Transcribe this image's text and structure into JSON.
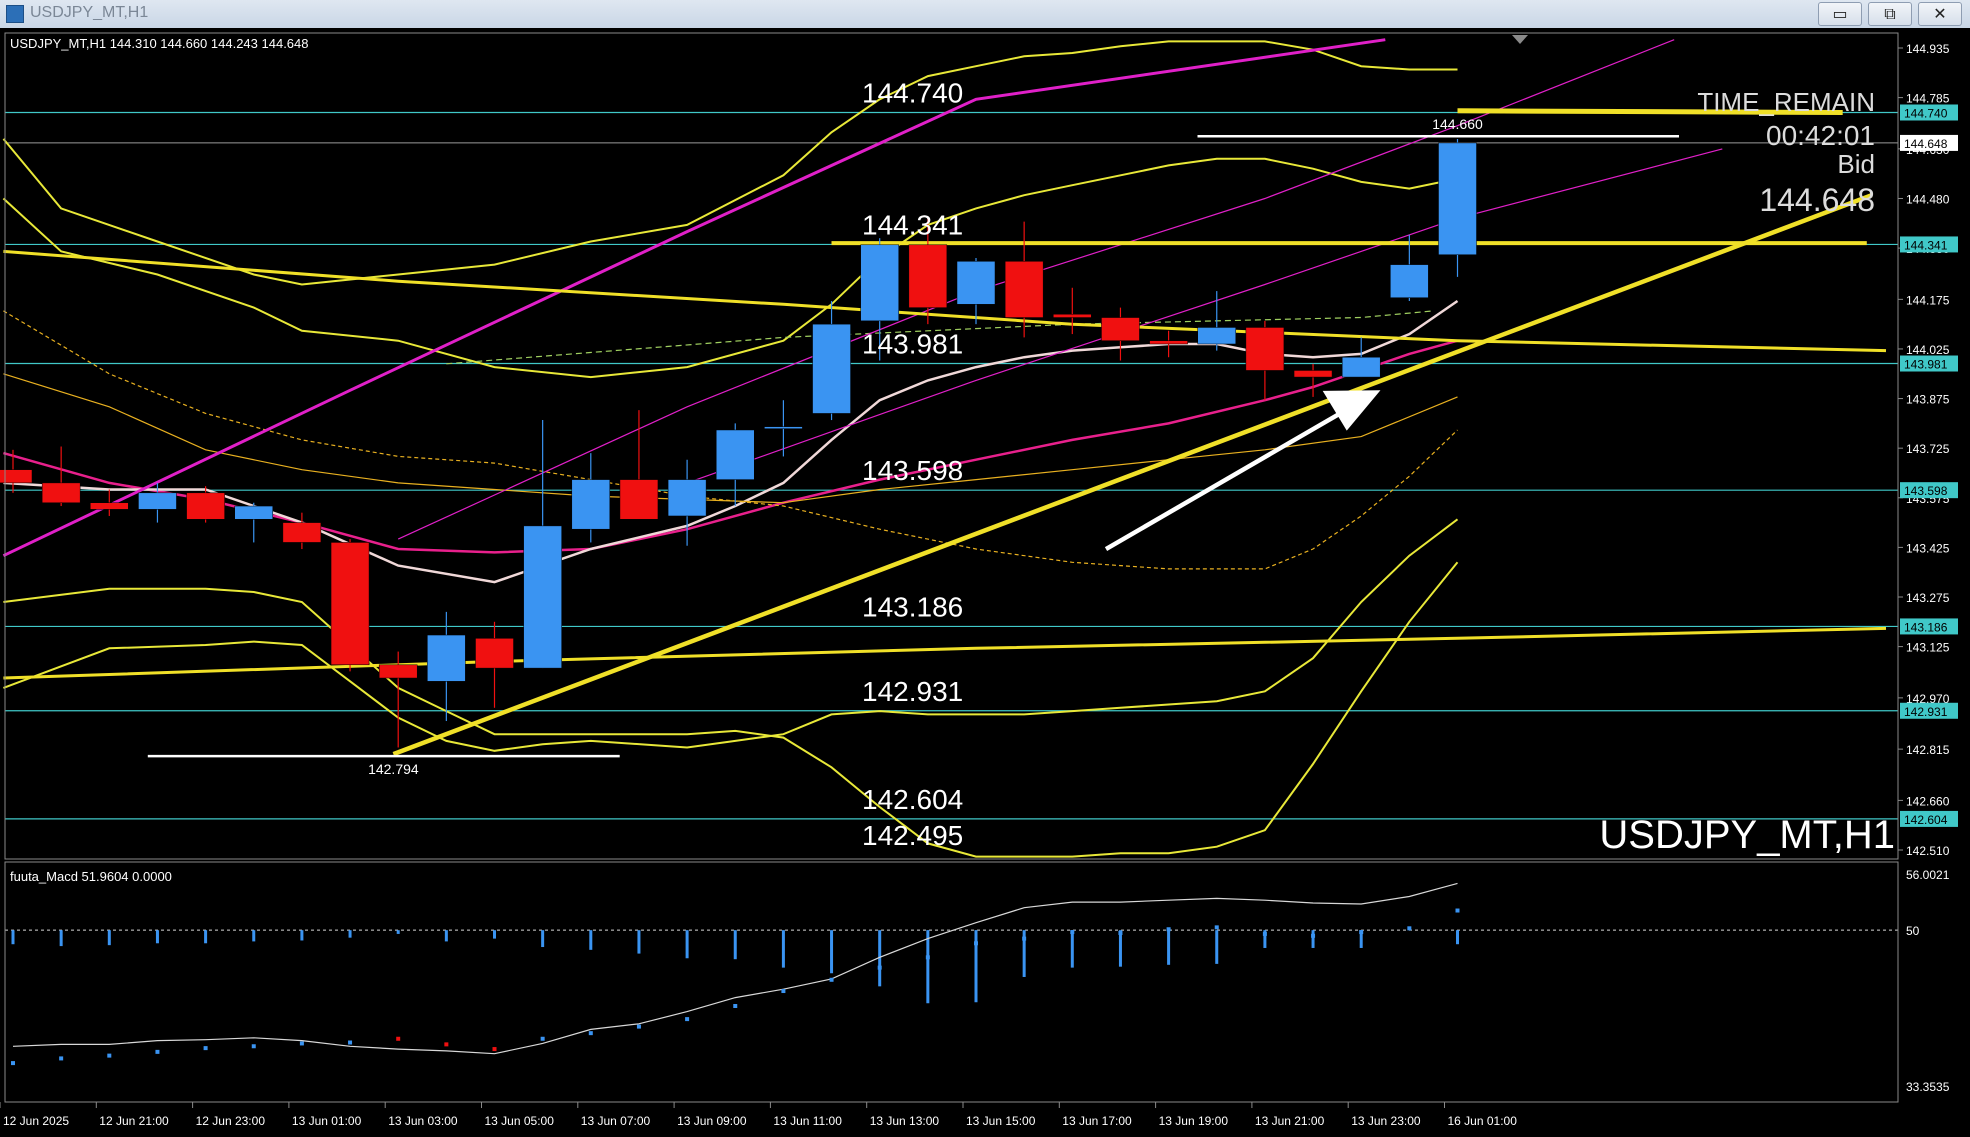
{
  "window": {
    "title": "USDJPY_MT,H1",
    "min_glyph": "▭",
    "max_glyph": "⧉",
    "close_glyph": "✕"
  },
  "header": {
    "symbol_info": "USDJPY_MT,H1  144.310 144.660 144.243 144.648"
  },
  "overlay": {
    "time_remain_label": "TIME_REMAIN",
    "time_remain_value": "00:42:01",
    "bid_label": "Bid",
    "bid_value": "144.648",
    "watermark": "USDJPY_MT,H1"
  },
  "colors": {
    "bull": "#3a94f2",
    "bear": "#f01010",
    "trend": "#f0e028",
    "level": "#40c8c8",
    "channel": "#e020c8",
    "band": "#e8e838",
    "ma_white": "#f0d8d8",
    "ma_pink": "#e8208c",
    "ma_orange": "#e8b020",
    "background": "#000000"
  },
  "chart_data": [
    {
      "type": "candlestick",
      "title": "USDJPY_MT,H1",
      "ylim": [
        142.51,
        144.935
      ],
      "y_ticks": [
        "144.935",
        "144.785",
        "144.630",
        "144.480",
        "144.330",
        "144.175",
        "144.025",
        "143.875",
        "143.725",
        "143.575",
        "143.425",
        "143.275",
        "143.125",
        "142.970",
        "142.815",
        "142.660",
        "142.510"
      ],
      "x_ticks": [
        {
          "i": 0,
          "label": "12 Jun 2025"
        },
        {
          "i": 2,
          "label": "12 Jun 21:00"
        },
        {
          "i": 4,
          "label": "12 Jun 23:00"
        },
        {
          "i": 6,
          "label": "13 Jun 01:00"
        },
        {
          "i": 8,
          "label": "13 Jun 03:00"
        },
        {
          "i": 10,
          "label": "13 Jun 05:00"
        },
        {
          "i": 12,
          "label": "13 Jun 07:00"
        },
        {
          "i": 14,
          "label": "13 Jun 09:00"
        },
        {
          "i": 16,
          "label": "13 Jun 11:00"
        },
        {
          "i": 18,
          "label": "13 Jun 13:00"
        },
        {
          "i": 20,
          "label": "13 Jun 15:00"
        },
        {
          "i": 22,
          "label": "13 Jun 17:00"
        },
        {
          "i": 24,
          "label": "13 Jun 19:00"
        },
        {
          "i": 26,
          "label": "13 Jun 21:00"
        },
        {
          "i": 28,
          "label": "13 Jun 23:00"
        },
        {
          "i": 30,
          "label": "16 Jun 01:00"
        }
      ],
      "candles": [
        {
          "o": 143.66,
          "h": 143.72,
          "l": 143.59,
          "c": 143.62
        },
        {
          "o": 143.62,
          "h": 143.73,
          "l": 143.55,
          "c": 143.56
        },
        {
          "o": 143.56,
          "h": 143.6,
          "l": 143.52,
          "c": 143.54
        },
        {
          "o": 143.54,
          "h": 143.62,
          "l": 143.5,
          "c": 143.59
        },
        {
          "o": 143.59,
          "h": 143.61,
          "l": 143.5,
          "c": 143.51
        },
        {
          "o": 143.51,
          "h": 143.56,
          "l": 143.44,
          "c": 143.55
        },
        {
          "o": 143.5,
          "h": 143.53,
          "l": 143.42,
          "c": 143.44
        },
        {
          "o": 143.44,
          "h": 143.45,
          "l": 143.05,
          "c": 143.07
        },
        {
          "o": 143.07,
          "h": 143.11,
          "l": 142.82,
          "c": 143.03
        },
        {
          "o": 143.02,
          "h": 143.23,
          "l": 142.9,
          "c": 143.16
        },
        {
          "o": 143.15,
          "h": 143.2,
          "l": 142.94,
          "c": 143.06
        },
        {
          "o": 143.06,
          "h": 143.81,
          "l": 143.06,
          "c": 143.49
        },
        {
          "o": 143.48,
          "h": 143.71,
          "l": 143.44,
          "c": 143.63
        },
        {
          "o": 143.63,
          "h": 143.84,
          "l": 143.56,
          "c": 143.51
        },
        {
          "o": 143.52,
          "h": 143.69,
          "l": 143.43,
          "c": 143.63
        },
        {
          "o": 143.63,
          "h": 143.8,
          "l": 143.55,
          "c": 143.78
        },
        {
          "o": 143.79,
          "h": 143.87,
          "l": 143.7,
          "c": 143.79
        },
        {
          "o": 143.83,
          "h": 144.17,
          "l": 143.81,
          "c": 144.1
        },
        {
          "o": 144.11,
          "h": 144.36,
          "l": 143.99,
          "c": 144.34
        },
        {
          "o": 144.34,
          "h": 144.42,
          "l": 144.1,
          "c": 144.15
        },
        {
          "o": 144.16,
          "h": 144.3,
          "l": 144.1,
          "c": 144.29
        },
        {
          "o": 144.29,
          "h": 144.41,
          "l": 144.06,
          "c": 144.12
        },
        {
          "o": 144.13,
          "h": 144.21,
          "l": 144.07,
          "c": 144.12
        },
        {
          "o": 144.12,
          "h": 144.15,
          "l": 143.99,
          "c": 144.05
        },
        {
          "o": 144.05,
          "h": 144.08,
          "l": 144.0,
          "c": 144.04
        },
        {
          "o": 144.04,
          "h": 144.2,
          "l": 144.02,
          "c": 144.09
        },
        {
          "o": 144.09,
          "h": 144.11,
          "l": 143.87,
          "c": 143.96
        },
        {
          "o": 143.96,
          "h": 143.98,
          "l": 143.88,
          "c": 143.94
        },
        {
          "o": 143.94,
          "h": 144.06,
          "l": 143.94,
          "c": 144.0
        },
        {
          "o": 144.18,
          "h": 144.37,
          "l": 144.17,
          "c": 144.28
        },
        {
          "o": 144.31,
          "h": 144.66,
          "l": 144.243,
          "c": 144.648
        }
      ],
      "levels": [
        {
          "price": 144.74,
          "label": "144.740",
          "tag": "144.740"
        },
        {
          "price": 144.341,
          "label": "144.341",
          "tag": "144.341"
        },
        {
          "price": 143.981,
          "label": "143.981",
          "tag": "143.981"
        },
        {
          "price": 143.598,
          "label": "143.598",
          "tag": "143.598"
        },
        {
          "price": 143.186,
          "label": "143.186",
          "tag": "143.186"
        },
        {
          "price": 142.931,
          "label": "142.931",
          "tag": "142.931"
        },
        {
          "price": 142.604,
          "label": "142.604",
          "tag": "142.604"
        },
        {
          "price": 142.495,
          "label": "142.495"
        }
      ],
      "current_price": {
        "price": 144.648,
        "tag": "144.648"
      },
      "annotations": [
        {
          "price": 144.66,
          "label": "144.660"
        },
        {
          "price": 142.794,
          "label": "142.794"
        }
      ]
    },
    {
      "type": "line+bar",
      "title": "fuuta_Macd 51.9604  0.0000",
      "ylim": [
        33.3535,
        56.0021
      ],
      "y_ticks": [
        "56.0021",
        "50",
        "33.3535"
      ],
      "zero_level": 50,
      "histogram": [
        48.5,
        48.3,
        48.4,
        48.6,
        48.6,
        48.8,
        48.9,
        49.2,
        49.6,
        48.8,
        49.1,
        48.2,
        47.9,
        47.5,
        47.0,
        46.9,
        46.0,
        45.4,
        44.0,
        42.2,
        42.3,
        45.0,
        46.0,
        46.1,
        46.3,
        46.4,
        48.1,
        48.1,
        48.1,
        50.3,
        48.5
      ],
      "signal": [
        37.6,
        37.8,
        37.8,
        38.2,
        38.3,
        38.5,
        38.2,
        37.6,
        37.3,
        37.1,
        36.8,
        37.9,
        39.4,
        40.0,
        41.3,
        42.8,
        43.7,
        44.8,
        47.1,
        49.1,
        50.8,
        52.4,
        53.0,
        53.0,
        53.2,
        53.4,
        53.2,
        52.9,
        52.8,
        53.6,
        55.0
      ],
      "dots": [
        35.8,
        36.3,
        36.6,
        37.0,
        37.4,
        37.6,
        37.9,
        38.0,
        38.4,
        37.8,
        37.3,
        38.4,
        39.0,
        39.7,
        40.5,
        41.9,
        43.5,
        44.7,
        46.0,
        47.1,
        48.6,
        49.1,
        49.8,
        49.7,
        50.1,
        50.3,
        49.6,
        49.4,
        49.8,
        50.2,
        52.1
      ]
    }
  ]
}
